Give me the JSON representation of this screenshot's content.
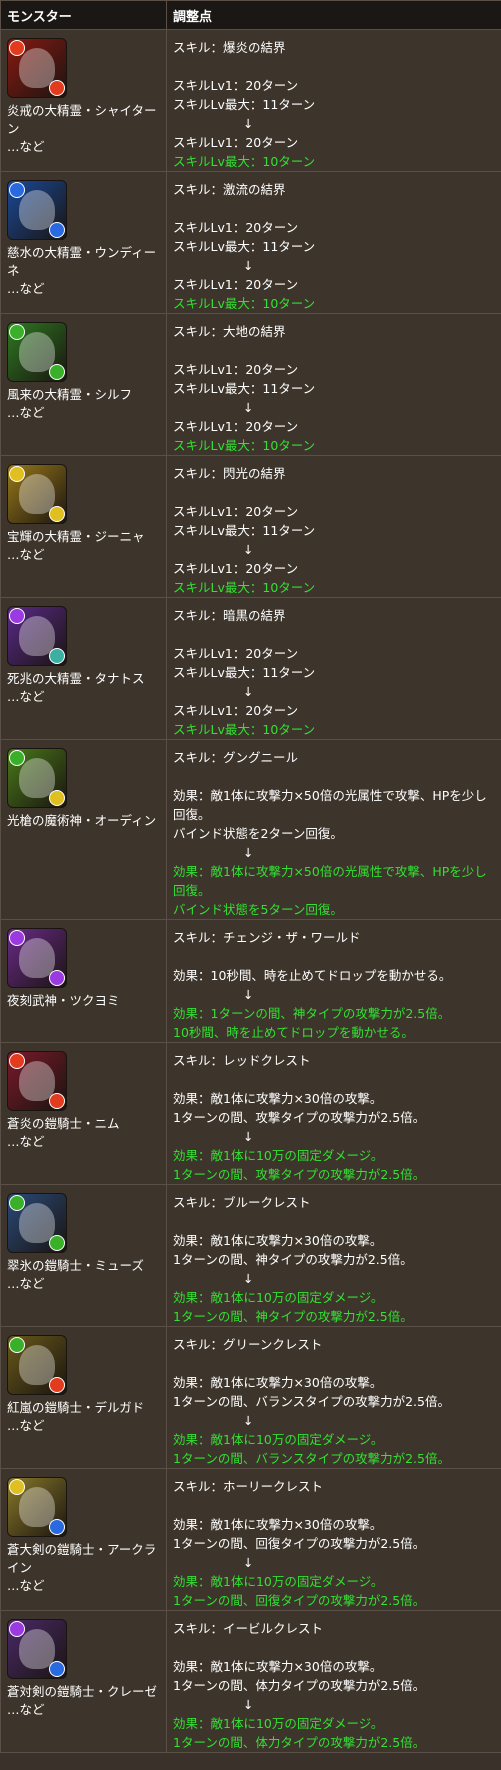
{
  "header": {
    "col1": "モンスター",
    "col2": "調整点"
  },
  "colors": {
    "new_text": "#33e033"
  },
  "rows": [
    {
      "icon": {
        "name": "fire-spirit-icon",
        "bg": "#8a1a12",
        "orb1": "#e23b1e",
        "orb2": "#e23b1e"
      },
      "name": "炎戒の大精霊・シャイターン",
      "suffix": "…など",
      "lines": [
        {
          "t": "スキル：爆炎の結界",
          "g": false
        },
        {
          "t": "",
          "g": false
        },
        {
          "t": "スキルLv1：20ターン",
          "g": false
        },
        {
          "t": "スキルLv最大：11ターン",
          "g": false
        },
        {
          "t": "↓",
          "g": false,
          "a": true
        },
        {
          "t": "スキルLv1：20ターン",
          "g": false
        },
        {
          "t": "スキルLv最大：10ターン",
          "g": true
        }
      ]
    },
    {
      "icon": {
        "name": "water-spirit-icon",
        "bg": "#1a4a9a",
        "orb1": "#2a6ae0",
        "orb2": "#2a6ae0"
      },
      "name": "慈水の大精霊・ウンディーネ",
      "suffix": "…など",
      "lines": [
        {
          "t": "スキル：激流の結界",
          "g": false
        },
        {
          "t": "",
          "g": false
        },
        {
          "t": "スキルLv1：20ターン",
          "g": false
        },
        {
          "t": "スキルLv最大：11ターン",
          "g": false
        },
        {
          "t": "↓",
          "g": false,
          "a": true
        },
        {
          "t": "スキルLv1：20ターン",
          "g": false
        },
        {
          "t": "スキルLv最大：10ターン",
          "g": true
        }
      ]
    },
    {
      "icon": {
        "name": "wood-spirit-icon",
        "bg": "#2e7a22",
        "orb1": "#3ab02a",
        "orb2": "#3ab02a"
      },
      "name": "風来の大精霊・シルフ",
      "suffix": "…など",
      "lines": [
        {
          "t": "スキル：大地の結界",
          "g": false
        },
        {
          "t": "",
          "g": false
        },
        {
          "t": "スキルLv1：20ターン",
          "g": false
        },
        {
          "t": "スキルLv最大：11ターン",
          "g": false
        },
        {
          "t": "↓",
          "g": false,
          "a": true
        },
        {
          "t": "スキルLv1：20ターン",
          "g": false
        },
        {
          "t": "スキルLv最大：10ターン",
          "g": true
        }
      ]
    },
    {
      "icon": {
        "name": "light-spirit-icon",
        "bg": "#9a7a1a",
        "orb1": "#e0c020",
        "orb2": "#e0c020"
      },
      "name": "宝輝の大精霊・ジーニャ",
      "suffix": "…など",
      "lines": [
        {
          "t": "スキル：閃光の結界",
          "g": false
        },
        {
          "t": "",
          "g": false
        },
        {
          "t": "スキルLv1：20ターン",
          "g": false
        },
        {
          "t": "スキルLv最大：11ターン",
          "g": false
        },
        {
          "t": "↓",
          "g": false,
          "a": true
        },
        {
          "t": "スキルLv1：20ターン",
          "g": false
        },
        {
          "t": "スキルLv最大：10ターン",
          "g": true
        }
      ]
    },
    {
      "icon": {
        "name": "dark-spirit-icon",
        "bg": "#5a2a8a",
        "orb1": "#9a3ae0",
        "orb2": "#3ab0a0"
      },
      "name": "死兆の大精霊・タナトス",
      "suffix": "…など",
      "lines": [
        {
          "t": "スキル：暗黒の結界",
          "g": false
        },
        {
          "t": "",
          "g": false
        },
        {
          "t": "スキルLv1：20ターン",
          "g": false
        },
        {
          "t": "スキルLv最大：11ターン",
          "g": false
        },
        {
          "t": "↓",
          "g": false,
          "a": true
        },
        {
          "t": "スキルLv1：20ターン",
          "g": false
        },
        {
          "t": "スキルLv最大：10ターン",
          "g": true
        }
      ]
    },
    {
      "icon": {
        "name": "odin-icon",
        "bg": "#4a7a1a",
        "orb1": "#3ab02a",
        "orb2": "#e0c020"
      },
      "name": "光槍の魔術神・オーディン",
      "suffix": "",
      "lines": [
        {
          "t": "スキル：グングニール",
          "g": false
        },
        {
          "t": "",
          "g": false
        },
        {
          "t": "効果：敵1体に攻撃力×50倍の光属性で攻撃、HPを少し回復。",
          "g": false
        },
        {
          "t": "バインド状態を2ターン回復。",
          "g": false
        },
        {
          "t": "↓",
          "g": false,
          "a": true
        },
        {
          "t": "効果：敵1体に攻撃力×50倍の光属性で攻撃、HPを少し回復。",
          "g": true
        },
        {
          "t": "バインド状態を5ターン回復。",
          "g": true
        }
      ]
    },
    {
      "icon": {
        "name": "tsukuyomi-icon",
        "bg": "#6a2a8a",
        "orb1": "#9a3ae0",
        "orb2": "#9a3ae0"
      },
      "name": "夜刻武神・ツクヨミ",
      "suffix": "",
      "lines": [
        {
          "t": "スキル：チェンジ・ザ・ワールド",
          "g": false
        },
        {
          "t": "",
          "g": false
        },
        {
          "t": "効果：10秒間、時を止めてドロップを動かせる。",
          "g": false
        },
        {
          "t": "↓",
          "g": false,
          "a": true
        },
        {
          "t": "効果：1ターンの間、神タイプの攻撃力が2.5倍。",
          "g": true
        },
        {
          "t": "10秒間、時を止めてドロップを動かせる。",
          "g": true
        }
      ]
    },
    {
      "icon": {
        "name": "nim-icon",
        "bg": "#7a1a2a",
        "orb1": "#e23b1e",
        "orb2": "#e23b1e"
      },
      "name": "蒼炎の鎧騎士・ニム",
      "suffix": "…など",
      "lines": [
        {
          "t": "スキル：レッドクレスト",
          "g": false
        },
        {
          "t": "",
          "g": false
        },
        {
          "t": "効果：敵1体に攻撃力×30倍の攻撃。",
          "g": false
        },
        {
          "t": "1ターンの間、攻撃タイプの攻撃力が2.5倍。",
          "g": false
        },
        {
          "t": "↓",
          "g": false,
          "a": true
        },
        {
          "t": "効果：敵1体に10万の固定ダメージ。",
          "g": true
        },
        {
          "t": "1ターンの間、攻撃タイプの攻撃力が2.5倍。",
          "g": true
        }
      ]
    },
    {
      "icon": {
        "name": "muse-icon",
        "bg": "#2a4a7a",
        "orb1": "#3ab02a",
        "orb2": "#3ab02a"
      },
      "name": "翠氷の鎧騎士・ミューズ",
      "suffix": "…など",
      "lines": [
        {
          "t": "スキル：ブルークレスト",
          "g": false
        },
        {
          "t": "",
          "g": false
        },
        {
          "t": "効果：敵1体に攻撃力×30倍の攻撃。",
          "g": false
        },
        {
          "t": "1ターンの間、神タイプの攻撃力が2.5倍。",
          "g": false
        },
        {
          "t": "↓",
          "g": false,
          "a": true
        },
        {
          "t": "効果：敵1体に10万の固定ダメージ。",
          "g": true
        },
        {
          "t": "1ターンの間、神タイプの攻撃力が2.5倍。",
          "g": true
        }
      ]
    },
    {
      "icon": {
        "name": "delgado-icon",
        "bg": "#6a5a1a",
        "orb1": "#3ab02a",
        "orb2": "#e23b1e"
      },
      "name": "紅嵐の鎧騎士・デルガド",
      "suffix": "…など",
      "lines": [
        {
          "t": "スキル：グリーンクレスト",
          "g": false
        },
        {
          "t": "",
          "g": false
        },
        {
          "t": "効果：敵1体に攻撃力×30倍の攻撃。",
          "g": false
        },
        {
          "t": "1ターンの間、バランスタイプの攻撃力が2.5倍。",
          "g": false
        },
        {
          "t": "↓",
          "g": false,
          "a": true
        },
        {
          "t": "効果：敵1体に10万の固定ダメージ。",
          "g": true
        },
        {
          "t": "1ターンの間、バランスタイプの攻撃力が2.5倍。",
          "g": true
        }
      ]
    },
    {
      "icon": {
        "name": "arcline-icon",
        "bg": "#8a7a2a",
        "orb1": "#e0c020",
        "orb2": "#2a6ae0"
      },
      "name": "蒼大剣の鎧騎士・アークライン",
      "suffix": "…など",
      "lines": [
        {
          "t": "スキル：ホーリークレスト",
          "g": false
        },
        {
          "t": "",
          "g": false
        },
        {
          "t": "効果：敵1体に攻撃力×30倍の攻撃。",
          "g": false
        },
        {
          "t": "1ターンの間、回復タイプの攻撃力が2.5倍。",
          "g": false
        },
        {
          "t": "↓",
          "g": false,
          "a": true
        },
        {
          "t": "効果：敵1体に10万の固定ダメージ。",
          "g": true
        },
        {
          "t": "1ターンの間、回復タイプの攻撃力が2.5倍。",
          "g": true
        }
      ]
    },
    {
      "icon": {
        "name": "crese-icon",
        "bg": "#4a2a6a",
        "orb1": "#9a3ae0",
        "orb2": "#2a6ae0"
      },
      "name": "蒼対剣の鎧騎士・クレーゼ",
      "suffix": "…など",
      "lines": [
        {
          "t": "スキル：イービルクレスト",
          "g": false
        },
        {
          "t": "",
          "g": false
        },
        {
          "t": "効果：敵1体に攻撃力×30倍の攻撃。",
          "g": false
        },
        {
          "t": "1ターンの間、体力タイプの攻撃力が2.5倍。",
          "g": false
        },
        {
          "t": "↓",
          "g": false,
          "a": true
        },
        {
          "t": "効果：敵1体に10万の固定ダメージ。",
          "g": true
        },
        {
          "t": "1ターンの間、体力タイプの攻撃力が2.5倍。",
          "g": true
        }
      ]
    }
  ]
}
